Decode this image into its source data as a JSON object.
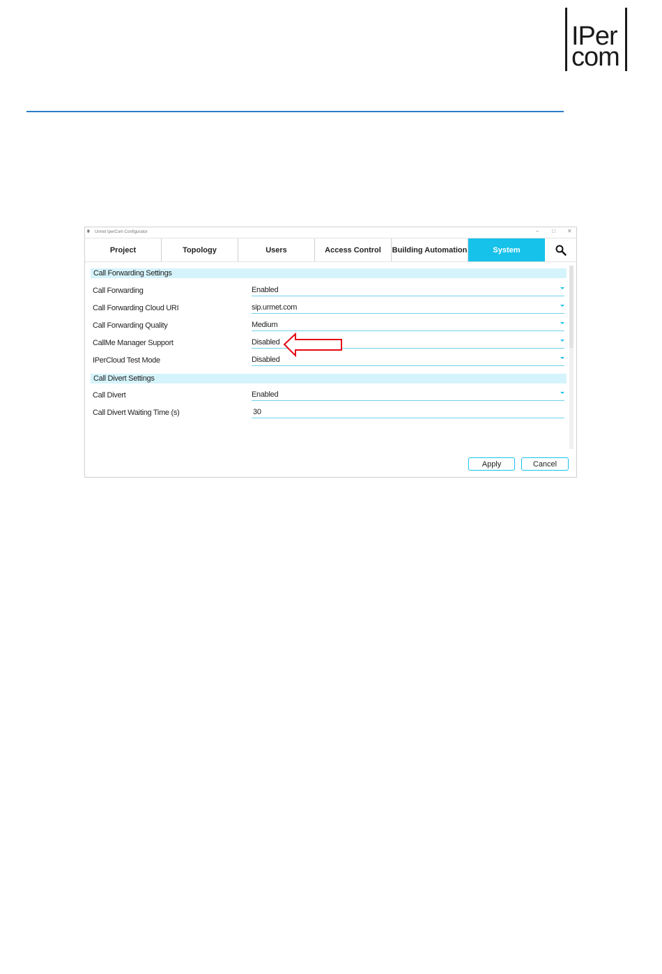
{
  "logo": {
    "line1": "IPer",
    "line2": "com"
  },
  "window": {
    "title": "Urmet IperCom Configurator",
    "controls": {
      "minimize": "–",
      "maximize": "□",
      "close": "✕"
    }
  },
  "tabs": [
    "Project",
    "Topology",
    "Users",
    "Access Control",
    "Building Automation",
    "System"
  ],
  "active_tab": "System",
  "sections": {
    "call_forwarding": {
      "title": "Call Forwarding Settings",
      "rows": [
        {
          "label": "Call Forwarding",
          "value": "Enabled"
        },
        {
          "label": "Call Forwarding Cloud URI",
          "value": "sip.urmet.com"
        },
        {
          "label": "Call Forwarding Quality",
          "value": "Medium"
        },
        {
          "label": "CallMe Manager Support",
          "value": "Disabled"
        },
        {
          "label": "IPerCloud Test Mode",
          "value": "Disabled"
        }
      ]
    },
    "call_divert": {
      "title": "Call Divert Settings",
      "rows": [
        {
          "label": "Call Divert",
          "value": "Enabled"
        },
        {
          "label": "Call Divert Waiting Time (s)",
          "value": "30"
        }
      ]
    }
  },
  "buttons": {
    "apply": "Apply",
    "cancel": "Cancel"
  },
  "colors": {
    "accent": "#17c2ea",
    "section_bg": "#d5f3fb",
    "rule": "#2b7bc8",
    "annotation": "#e30613"
  },
  "icons": {
    "search": "search-icon",
    "annotation": "arrow-left-icon"
  }
}
